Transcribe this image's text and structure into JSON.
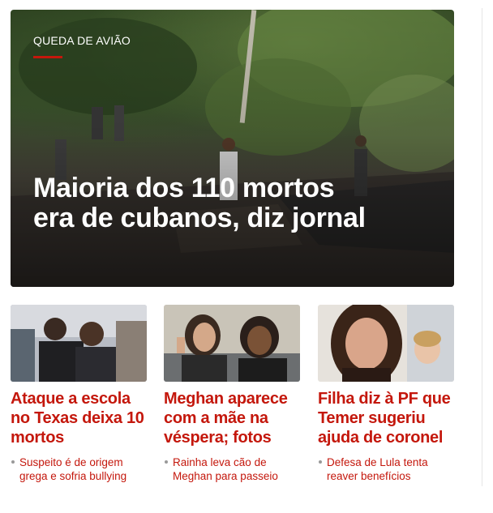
{
  "hero": {
    "tag": "QUEDA DE AVIÃO",
    "title": "Maioria dos 110 mortos era de cubanos, diz jornal",
    "accent_color": "#c4170c"
  },
  "cards": [
    {
      "title": "Ataque a escola no Texas deixa 10 mortos",
      "related": "Suspeito é de origem grega e sofria bullying"
    },
    {
      "title": "Meghan aparece com a mãe na véspera; fotos",
      "related": "Rainha leva cão de Meghan para passeio"
    },
    {
      "title": "Filha diz à PF que Temer sugeriu ajuda de coronel",
      "related": "Defesa de Lula tenta reaver benefícios"
    }
  ]
}
